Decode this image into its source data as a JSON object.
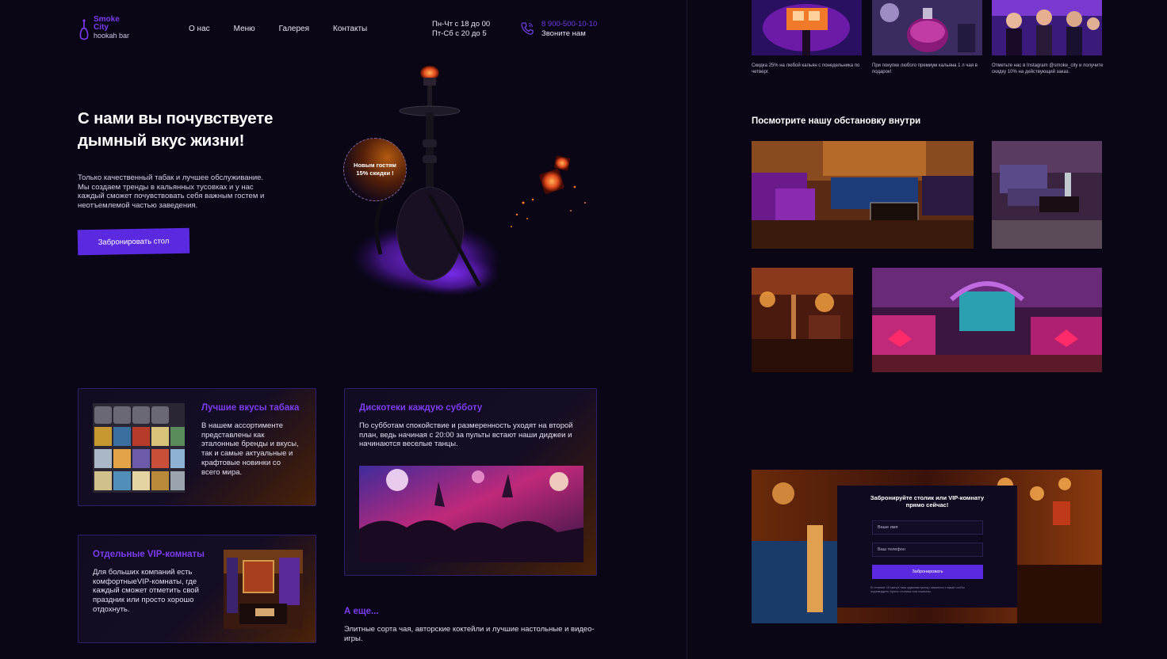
{
  "header": {
    "logo_name": "Smoke City",
    "logo_sub": "hookah bar",
    "nav": [
      "О нас",
      "Меню",
      "Галерея",
      "Контакты"
    ],
    "hours_line1": "Пн-Чт с 18 до 00",
    "hours_line2": "Пт-Сб с 20 до 5",
    "phone": "8 900-500-10-10",
    "phone_cta": "Звоните нам"
  },
  "hero": {
    "title": "С нами вы почувствуете дымный вкус жизни!",
    "text": "Только качественный табак и лучшее обслуживание. Мы создаем тренды в кальянных тусовках и у нас каждый сможет почувствовать себя важным гостем и неотъемлемой частью заведения.",
    "button": "Забронировать стол",
    "promo_badge": "Новым гостям 15% скидки !"
  },
  "features": [
    {
      "title": "Лучшие вкусы табака",
      "text": "В нашем ассортименте представлены как эталонные бренды и вкусы, так и самые актуальные и крафтовые новинки со всего мира."
    },
    {
      "title": "Дискотеки каждую субботу",
      "text": "По субботам спокойствие и размеренность уходят на второй план, ведь начиная с 20:00 за пульты встают наши диджеи и начинаются веселые танцы."
    },
    {
      "title": "Отдельные VIP-комнаты",
      "text": "Для больших компаний есть комфортныеVIP-комнаты, где каждый сможет отметить свой праздник или просто хорошо отдохнуть."
    }
  ],
  "more": {
    "title": "А еще...",
    "text": "Элитные сорта чая, авторские коктейли и лучшие настольные и видео-игры."
  },
  "promos": [
    "Скидка 25% на любой кальян с понедельника по четверг.",
    "При покупке любого премиум кальяна 1 л чая в подарок!",
    "Отметьте нас в Instagram @smoke_city и получите скидку 10% на действующий заказ."
  ],
  "gallery": {
    "title": "Посмотрите нашу обстановку внутри"
  },
  "booking": {
    "title": "Забронируйте столик или VIP-комнату прямо сейчас!",
    "name_placeholder": "Ваше имя",
    "phone_placeholder": "Ваш телефон",
    "button": "Забронировать",
    "note": "В течение 15 минут наш администратор свяжется с вами чтобы подтвердить бронь столика или комнаты."
  },
  "colors": {
    "background": "#0a0616",
    "accent": "#7c3df2",
    "button": "#5b2ae0"
  }
}
